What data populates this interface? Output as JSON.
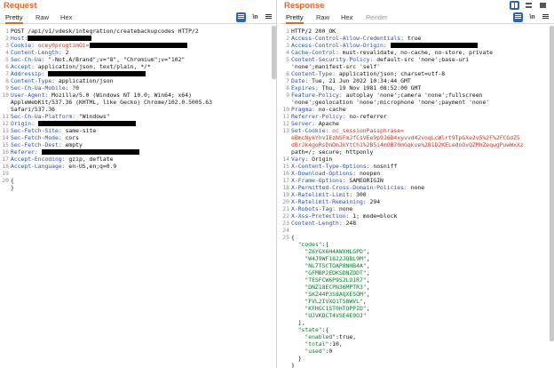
{
  "request": {
    "title": "Request",
    "tabs": [
      "Pretty",
      "Raw",
      "Hex"
    ],
    "newline_label": "\\n",
    "lines": [
      {
        "n": "1",
        "parts": [
          {
            "t": "POST /api/v1/vdesk/integration/createbackupcodes HTTP/2"
          }
        ]
      },
      {
        "n": "2",
        "parts": [
          {
            "k": "Host:"
          },
          {
            "r": 72
          }
        ]
      },
      {
        "n": "3",
        "parts": [
          {
            "k": "Cookie:"
          },
          {
            "c": " ocey0progtimOi="
          },
          {
            "r": 110
          }
        ]
      },
      {
        "n": "4",
        "parts": [
          {
            "k": "Content-Length:"
          },
          {
            "t": " 2"
          }
        ]
      },
      {
        "n": "5",
        "parts": [
          {
            "k": "Sec-Ch-Ua:"
          },
          {
            "t": " \"-Not.A/Brand\";v=\"8\", \"Chromium\";v=\"102\""
          }
        ]
      },
      {
        "n": "6",
        "parts": [
          {
            "k": "Accept:"
          },
          {
            "t": " application/json, text/plain, */*"
          }
        ]
      },
      {
        "n": "7",
        "parts": [
          {
            "k": "Addressip:"
          },
          {
            "t": " "
          },
          {
            "r": 110
          }
        ]
      },
      {
        "n": "8",
        "parts": [
          {
            "k": "Content-Type:"
          },
          {
            "t": " application/json"
          }
        ]
      },
      {
        "n": "9",
        "parts": [
          {
            "k": "Sec-Ch-Ua-Mobile:"
          },
          {
            "t": " ?0"
          }
        ]
      },
      {
        "n": "10",
        "parts": [
          {
            "k": "User-Agent:"
          },
          {
            "t": " Mozilla/5.0 (Windows NT 10.0; Win64; x64)"
          }
        ]
      },
      {
        "n": "",
        "parts": [
          {
            "t": "AppleWebKit/537.36 (KHTML, like Gecko) Chrome/102.0.5005.63"
          }
        ]
      },
      {
        "n": "",
        "parts": [
          {
            "t": "Safari/537.36"
          }
        ]
      },
      {
        "n": "11",
        "parts": [
          {
            "k": "Sec-Ch-Ua-Platform:"
          },
          {
            "t": " \"Windows\""
          }
        ]
      },
      {
        "n": "12",
        "parts": [
          {
            "k": "Origin:"
          },
          {
            "t": " "
          },
          {
            "r": 110
          }
        ]
      },
      {
        "n": "13",
        "parts": [
          {
            "k": "Sec-Fetch-Site:"
          },
          {
            "t": " same-site"
          }
        ]
      },
      {
        "n": "14",
        "parts": [
          {
            "k": "Sec-Fetch-Mode:"
          },
          {
            "t": " cors"
          }
        ]
      },
      {
        "n": "15",
        "parts": [
          {
            "k": "Sec-Fetch-Dest:"
          },
          {
            "t": " empty"
          }
        ]
      },
      {
        "n": "16",
        "parts": [
          {
            "k": "Referer:"
          },
          {
            "t": " "
          },
          {
            "r": 110
          }
        ]
      },
      {
        "n": "17",
        "parts": [
          {
            "k": "Accept-Encoding:"
          },
          {
            "t": " gzip, deflate"
          }
        ]
      },
      {
        "n": "18",
        "parts": [
          {
            "k": "Accept-Language:"
          },
          {
            "t": " en-US,en;q=0.9"
          }
        ]
      },
      {
        "n": "19",
        "parts": []
      },
      {
        "n": "20",
        "parts": [
          {
            "t": "{"
          }
        ]
      },
      {
        "n": "",
        "parts": [
          {
            "t": "}"
          }
        ]
      }
    ]
  },
  "response": {
    "title": "Response",
    "tabs": [
      "Pretty",
      "Raw",
      "Hex",
      "Render"
    ],
    "newline_label": "\\n",
    "lines": [
      {
        "n": "1",
        "parts": [
          {
            "t": "HTTP/2 200 OK"
          }
        ]
      },
      {
        "n": "2",
        "parts": [
          {
            "k": "Access-Control-Allow-Credentials:"
          },
          {
            "t": " true"
          }
        ]
      },
      {
        "n": "3",
        "parts": [
          {
            "k": "Access-Control-Allow-Origin:"
          },
          {
            "t": " "
          },
          {
            "r": 98
          }
        ]
      },
      {
        "n": "4",
        "parts": [
          {
            "k": "Cache-Control:"
          },
          {
            "t": " must-revalidate, no-cache, no-store, private"
          }
        ]
      },
      {
        "n": "5",
        "parts": [
          {
            "k": "Content-Security-Policy:"
          },
          {
            "t": " default-src 'none';base-uri"
          }
        ]
      },
      {
        "n": "",
        "parts": [
          {
            "t": "'none';manifest-src 'self'"
          }
        ]
      },
      {
        "n": "6",
        "parts": [
          {
            "k": "Content-Type:"
          },
          {
            "t": " application/json; charset=utf-8"
          }
        ]
      },
      {
        "n": "7",
        "parts": [
          {
            "k": "Date:"
          },
          {
            "t": " Tue, 21 Jun 2022 10:34:44 GMT"
          }
        ]
      },
      {
        "n": "8",
        "parts": [
          {
            "k": "Expires:"
          },
          {
            "t": " Thu, 19 Nov 1981 08:52:00 GMT"
          }
        ]
      },
      {
        "n": "9",
        "parts": [
          {
            "k": "Feature-Policy:"
          },
          {
            "t": " autoplay 'none';camera 'none';fullscreen"
          }
        ]
      },
      {
        "n": "",
        "parts": [
          {
            "t": "'none';geolocation 'none';microphone 'none';payment 'none'"
          }
        ]
      },
      {
        "n": "10",
        "parts": [
          {
            "k": "Pragma:"
          },
          {
            "t": " no-cache"
          }
        ]
      },
      {
        "n": "11",
        "parts": [
          {
            "k": "Referrer-Policy:"
          },
          {
            "t": " no-referrer"
          }
        ]
      },
      {
        "n": "12",
        "parts": [
          {
            "k": "Server:"
          },
          {
            "t": " Apache"
          }
        ]
      },
      {
        "n": "13",
        "parts": [
          {
            "k": "Set-Cookie:"
          },
          {
            "c": " oc_sessionPassphrase="
          }
        ]
      },
      {
        "n": "",
        "parts": [
          {
            "c": "eBmcNykYhvIEzNSFmJfCsVEe9p9J6D4xyvvd42voqLcWlrt9TpGXe2v5%2F%2FCGdZ5"
          }
        ]
      },
      {
        "n": "",
        "parts": [
          {
            "c": "dBrJk4goRsDnDmJkYtCh1%2B5i4mOB70mGqkve%2B1D2KELedoOvQZMhZeqwgPuwWxXz"
          }
        ]
      },
      {
        "n": "",
        "parts": [
          {
            "t": "path=/; secure; httponly"
          }
        ]
      },
      {
        "n": "14",
        "parts": [
          {
            "k": "Vary:"
          },
          {
            "t": " Origin"
          }
        ]
      },
      {
        "n": "15",
        "parts": [
          {
            "k": "X-Content-Type-Options:"
          },
          {
            "t": " nosniff"
          }
        ]
      },
      {
        "n": "16",
        "parts": [
          {
            "k": "X-Download-Options:"
          },
          {
            "t": " noopen"
          }
        ]
      },
      {
        "n": "17",
        "parts": [
          {
            "k": "X-Frame-Options:"
          },
          {
            "t": " SAMEORIGIN"
          }
        ]
      },
      {
        "n": "18",
        "parts": [
          {
            "k": "X-Permitted-Cross-Domain-Policies:"
          },
          {
            "t": " none"
          }
        ]
      },
      {
        "n": "19",
        "parts": [
          {
            "k": "X-Ratelimit-Limit:"
          },
          {
            "t": " 300"
          }
        ]
      },
      {
        "n": "20",
        "parts": [
          {
            "k": "X-Ratelimit-Remaining:"
          },
          {
            "t": " 294"
          }
        ]
      },
      {
        "n": "21",
        "parts": [
          {
            "k": "X-Robots-Tag:"
          },
          {
            "t": " none"
          }
        ]
      },
      {
        "n": "22",
        "parts": [
          {
            "k": "X-Xss-Protection:"
          },
          {
            "t": " 1; mode=block"
          }
        ]
      },
      {
        "n": "23",
        "parts": [
          {
            "k": "Content-Length:"
          },
          {
            "t": " 248"
          }
        ]
      },
      {
        "n": "24",
        "parts": []
      },
      {
        "n": "25",
        "parts": [
          {
            "t": "{"
          }
        ]
      },
      {
        "n": "",
        "parts": [
          {
            "t": "  "
          },
          {
            "s": "\"codes\""
          },
          {
            "t": ":["
          }
        ]
      },
      {
        "n": "",
        "parts": [
          {
            "t": "    "
          },
          {
            "s": "\"Z6YGX6H4AWXHLGPD\""
          },
          {
            "t": ","
          }
        ]
      },
      {
        "n": "",
        "parts": [
          {
            "t": "    "
          },
          {
            "s": "\"W4J9WF1822JQBL9M\""
          },
          {
            "t": ","
          }
        ]
      },
      {
        "n": "",
        "parts": [
          {
            "t": "    "
          },
          {
            "s": "\"NL7TSCTOAP8NHB4A\""
          },
          {
            "t": ","
          }
        ]
      },
      {
        "n": "",
        "parts": [
          {
            "t": "    "
          },
          {
            "s": "\"GFMBP2EDKSDNZDDT\""
          },
          {
            "t": ","
          }
        ]
      },
      {
        "n": "",
        "parts": [
          {
            "t": "    "
          },
          {
            "s": "\"TESFCW6P9S2LO1R7\""
          },
          {
            "t": ","
          }
        ]
      },
      {
        "n": "",
        "parts": [
          {
            "t": "    "
          },
          {
            "s": "\"DNZ18ECPN36MPTR3\""
          },
          {
            "t": ","
          }
        ]
      },
      {
        "n": "",
        "parts": [
          {
            "t": "    "
          },
          {
            "s": "\"SKZ44P3S8AQXE5OM\""
          },
          {
            "t": ","
          }
        ]
      },
      {
        "n": "",
        "parts": [
          {
            "t": "    "
          },
          {
            "s": "\"FVL2IVXQ1TS8WVL\""
          },
          {
            "t": ","
          }
        ]
      },
      {
        "n": "",
        "parts": [
          {
            "t": "    "
          },
          {
            "s": "\"KFHGC1ST0HTOPPID\""
          },
          {
            "t": ","
          }
        ]
      },
      {
        "n": "",
        "parts": [
          {
            "t": "    "
          },
          {
            "s": "\"UJVKDCT4VSE4E0OJ\""
          }
        ]
      },
      {
        "n": "",
        "parts": [
          {
            "t": "  ],"
          }
        ]
      },
      {
        "n": "",
        "parts": [
          {
            "t": "  "
          },
          {
            "s": "\"state\""
          },
          {
            "t": ":{"
          }
        ]
      },
      {
        "n": "",
        "parts": [
          {
            "t": "    "
          },
          {
            "s": "\"enabled\""
          },
          {
            "t": ":true,"
          }
        ]
      },
      {
        "n": "",
        "parts": [
          {
            "t": "    "
          },
          {
            "s": "\"total\""
          },
          {
            "t": ":10,"
          }
        ]
      },
      {
        "n": "",
        "parts": [
          {
            "t": "    "
          },
          {
            "s": "\"used\""
          },
          {
            "t": ":0"
          }
        ]
      },
      {
        "n": "",
        "parts": [
          {
            "t": "  }"
          }
        ]
      },
      {
        "n": "",
        "parts": [
          {
            "t": "}"
          }
        ]
      }
    ]
  },
  "colors": {
    "accent": "#e8632a",
    "header_key": "#2a4fa0",
    "json_string": "#0a7a2a",
    "cookie_value": "#c0392b",
    "action_button": "#2c63b8"
  },
  "icons": [
    "split-horizontal-icon",
    "split-vertical-icon",
    "single-pane-icon",
    "pretty-print-icon",
    "newline-icon",
    "menu-icon"
  ]
}
